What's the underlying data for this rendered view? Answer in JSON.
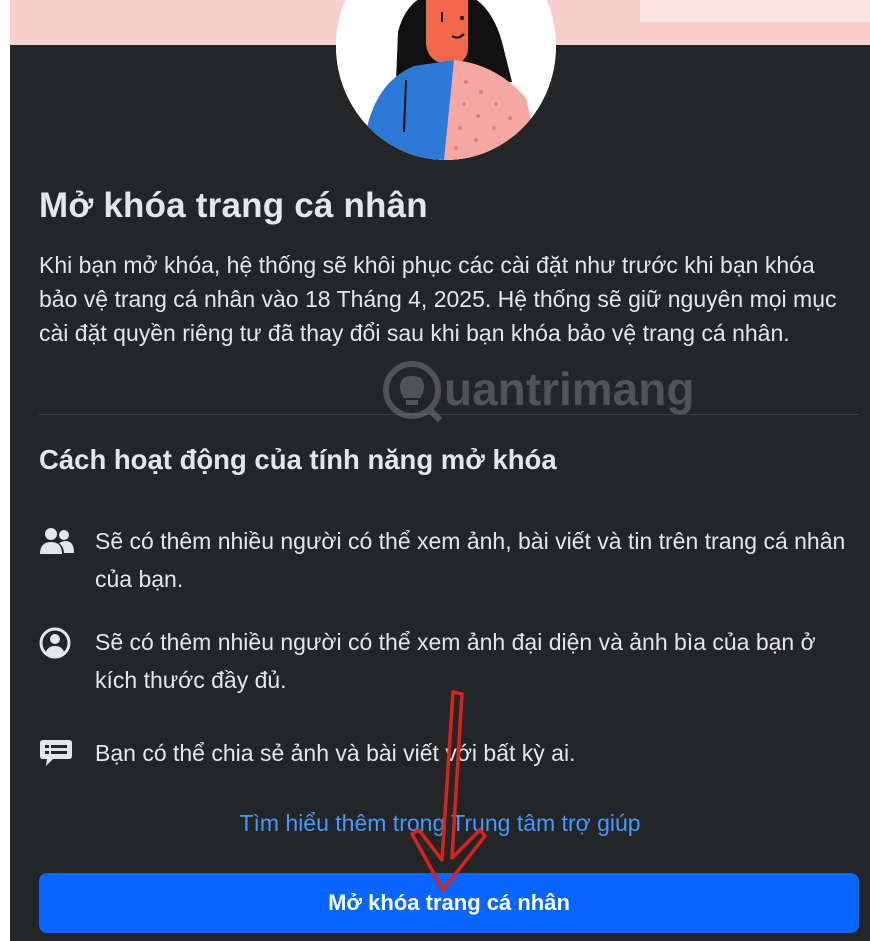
{
  "header": {
    "title": "Mở khóa trang cá nhân",
    "description": "Khi bạn mở khóa, hệ thống sẽ khôi phục các cài đặt như trước khi bạn khóa bảo vệ trang cá nhân vào 18 Tháng 4, 2025. Hệ thống sẽ giữ nguyên mọi mục cài đặt quyền riêng tư đã thay đổi sau khi bạn khóa bảo vệ trang cá nhân."
  },
  "how_it_works": {
    "title": "Cách hoạt động của tính năng mở khóa",
    "items": [
      {
        "icon": "people-icon",
        "text": "Sẽ có thêm nhiều người có thể xem ảnh, bài viết và tin trên trang cá nhân của bạn."
      },
      {
        "icon": "profile-circle-icon",
        "text": "Sẽ có thêm nhiều người có thể xem ảnh đại diện và ảnh bìa của bạn ở kích thước đầy đủ."
      },
      {
        "icon": "speech-bubble-icon",
        "text": "Bạn có thể chia sẻ ảnh và bài viết với bất kỳ ai."
      }
    ]
  },
  "help_link": "Tìm hiểu thêm trong Trung tâm trợ giúp",
  "unlock_button": "Mở khóa trang cá nhân",
  "watermark": "uantrimang",
  "colors": {
    "background": "#242526",
    "text": "#e4e6eb",
    "link": "#4599ff",
    "button": "#0866ff",
    "banner": "#f8cfcc",
    "arrow": "#d8221f"
  }
}
